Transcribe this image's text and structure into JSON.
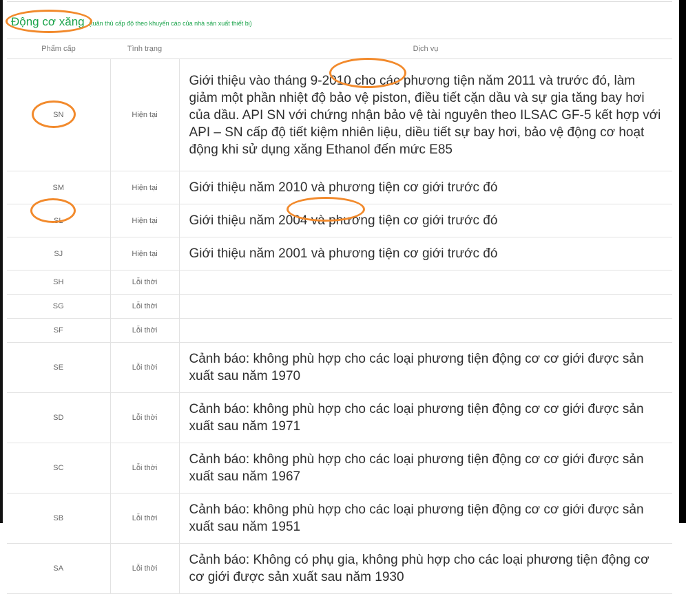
{
  "header": {
    "title": "Động cơ xăng",
    "note": "(tuân thủ cấp độ theo khuyến cáo của nhà sản xuất thiết bị)"
  },
  "columns": [
    "Phẩm cấp",
    "Tình trạng",
    "Dịch vụ"
  ],
  "rows": [
    {
      "grade": "SN",
      "status": "Hiện tại",
      "service": "Giới thiệu vào tháng 9-2010 cho các phương tiện năm 2011 và trước đó, làm giảm một phần nhiệt độ bảo vệ piston, điều tiết cặn dầu và sự gia tăng bay hơi của dầu. API SN với chứng nhận bảo vệ tài nguyên theo ILSAC GF-5 kết hợp với API – SN cấp độ tiết kiệm nhiên liệu, diều tiết sự bay hơi, bảo vệ động cơ hoạt động khi sử dụng xăng Ethanol đến mức E85"
    },
    {
      "grade": "SM",
      "status": "Hiện tại",
      "service": "Giới thiệu năm 2010 và phương tiện cơ giới trước đó"
    },
    {
      "grade": "SL",
      "status": "Hiện tại",
      "service": "Giới thiệu năm 2004 và phương tiện cơ giới trước đó"
    },
    {
      "grade": "SJ",
      "status": "Hiện tại",
      "service": "Giới thiệu năm 2001 và phương tiện cơ giới trước đó"
    },
    {
      "grade": "SH",
      "status": "Lỗi thời",
      "service": ""
    },
    {
      "grade": "SG",
      "status": "Lỗi thời",
      "service": ""
    },
    {
      "grade": "SF",
      "status": "Lỗi thời",
      "service": ""
    },
    {
      "grade": "SE",
      "status": "Lỗi thời",
      "service": "Cảnh báo: không phù hợp cho các loại phương tiện động cơ cơ giới được sản xuất sau năm 1970"
    },
    {
      "grade": "SD",
      "status": "Lỗi thời",
      "service": "Cảnh báo: không phù hợp cho các loại phương tiện động cơ cơ giới được sản xuất sau năm 1971"
    },
    {
      "grade": "SC",
      "status": "Lỗi thời",
      "service": "Cảnh báo: không phù hợp cho các loại phương tiện động cơ cơ giới được sản xuất sau năm 1967"
    },
    {
      "grade": "SB",
      "status": "Lỗi thời",
      "service": "Cảnh báo: không phù hợp cho các loại phương tiện động cơ cơ giới được sản xuất sau năm 1951"
    },
    {
      "grade": "SA",
      "status": "Lỗi thời",
      "service": "Cảnh báo: Không có phụ gia, không phù hợp cho các loại phương tiện động cơ cơ giới được sản xuất sau năm 1930"
    }
  ],
  "highlight_color": "#f28a2c"
}
